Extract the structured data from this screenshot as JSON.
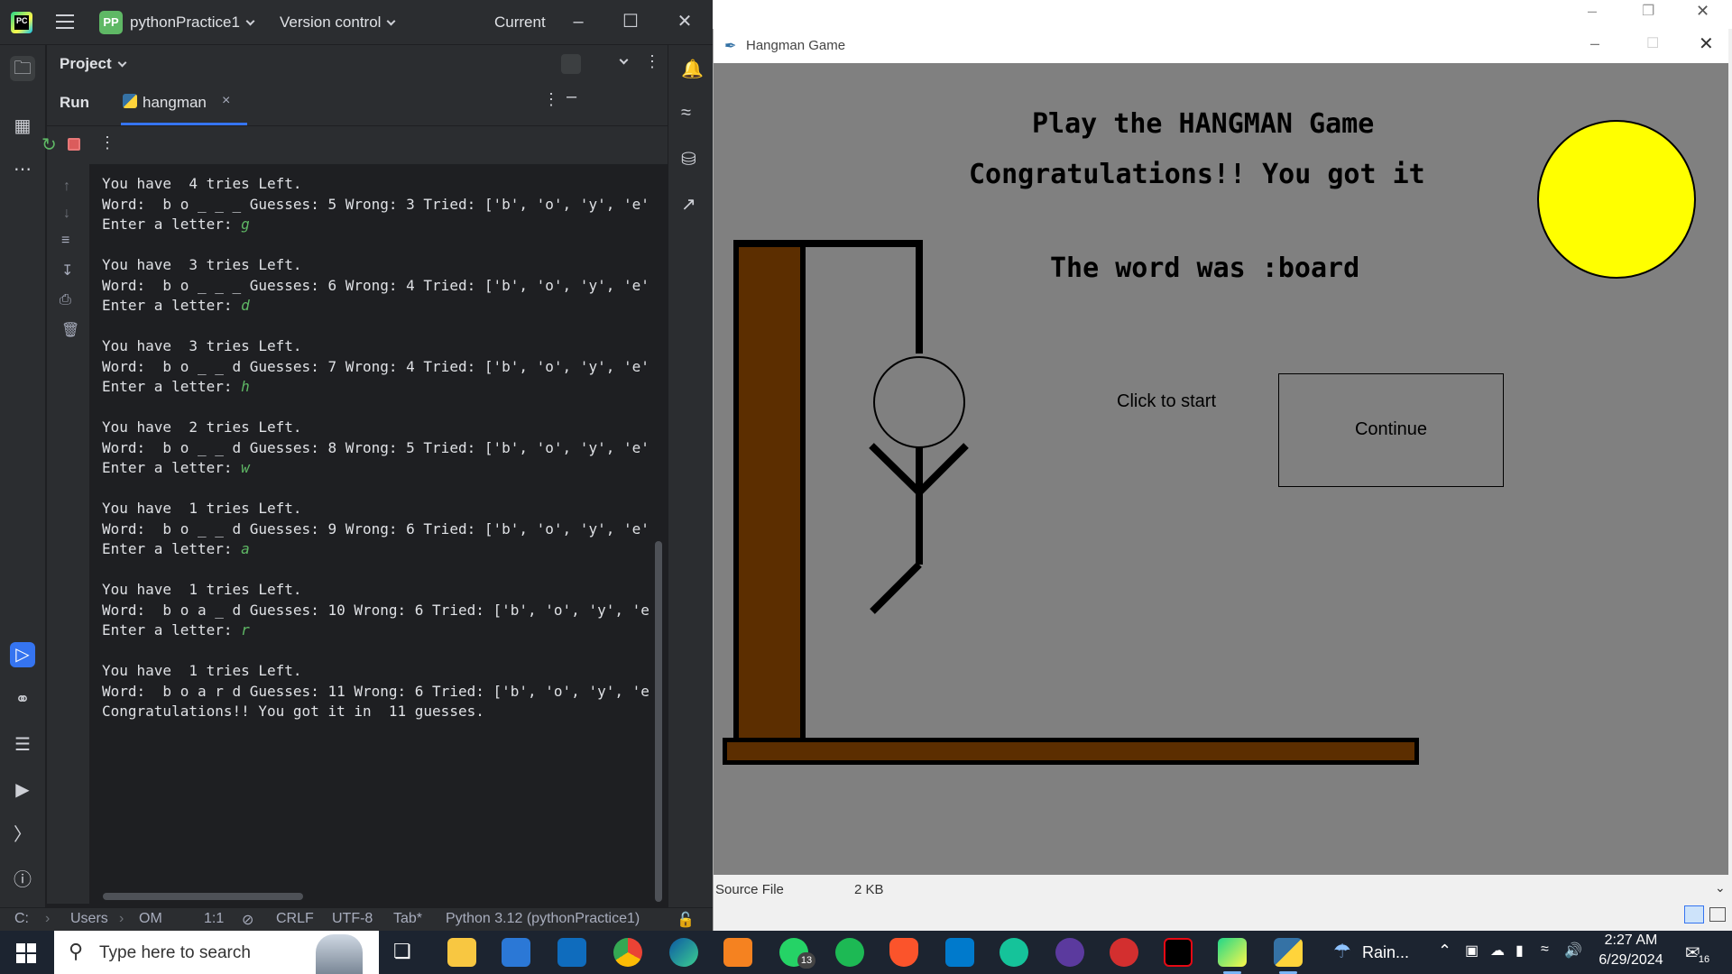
{
  "ide": {
    "project_badge": "PP",
    "project_name": "pythonPractice1",
    "version_control": "Version control",
    "run_config": "Current",
    "project_panel": "Project",
    "run_tab": "Run",
    "file_tab": "hangman",
    "console_lines": [
      {
        "text": "You have  4 tries Left."
      },
      {
        "text": "Word:  b o _ _ _ Guesses: 5 Wrong: 3 Tried: ['b', 'o', 'y', 'e'"
      },
      {
        "text": "Enter a letter: ",
        "input": "g"
      },
      {
        "text": ""
      },
      {
        "text": "You have  3 tries Left."
      },
      {
        "text": "Word:  b o _ _ _ Guesses: 6 Wrong: 4 Tried: ['b', 'o', 'y', 'e'"
      },
      {
        "text": "Enter a letter: ",
        "input": "d"
      },
      {
        "text": ""
      },
      {
        "text": "You have  3 tries Left."
      },
      {
        "text": "Word:  b o _ _ d Guesses: 7 Wrong: 4 Tried: ['b', 'o', 'y', 'e'"
      },
      {
        "text": "Enter a letter: ",
        "input": "h"
      },
      {
        "text": ""
      },
      {
        "text": "You have  2 tries Left."
      },
      {
        "text": "Word:  b o _ _ d Guesses: 8 Wrong: 5 Tried: ['b', 'o', 'y', 'e'"
      },
      {
        "text": "Enter a letter: ",
        "input": "w"
      },
      {
        "text": ""
      },
      {
        "text": "You have  1 tries Left."
      },
      {
        "text": "Word:  b o _ _ d Guesses: 9 Wrong: 6 Tried: ['b', 'o', 'y', 'e'"
      },
      {
        "text": "Enter a letter: ",
        "input": "a"
      },
      {
        "text": ""
      },
      {
        "text": "You have  1 tries Left."
      },
      {
        "text": "Word:  b o a _ d Guesses: 10 Wrong: 6 Tried: ['b', 'o', 'y', 'e"
      },
      {
        "text": "Enter a letter: ",
        "input": "r"
      },
      {
        "text": ""
      },
      {
        "text": "You have  1 tries Left."
      },
      {
        "text": "Word:  b o a r d Guesses: 11 Wrong: 6 Tried: ['b', 'o', 'y', 'e"
      },
      {
        "text": "Congratulations!! You got it in  11 guesses."
      }
    ],
    "status": {
      "path_drive": "C:",
      "path_users": "Users",
      "path_user": "OM",
      "position": "1:1",
      "line_sep": "CRLF",
      "encoding": "UTF-8",
      "indent": "Tab*",
      "interpreter": "Python 3.12 (pythonPractice1)"
    }
  },
  "hangman": {
    "window_title": "Hangman Game",
    "heading": "Play the HANGMAN Game",
    "message": "Congratulations!! You got it",
    "word_reveal": "The word was :board",
    "start_label": "Click to start",
    "continue_label": "Continue",
    "colors": {
      "canvas": "#808080",
      "gallows": "#5c2e00",
      "sun": "#ffff00"
    },
    "file_type": "Source File",
    "file_size": "2 KB"
  },
  "taskbar": {
    "search_placeholder": "Type here to search",
    "whatsapp_badge": "13",
    "weather": "Rain...",
    "time": "2:27 AM",
    "date": "6/29/2024",
    "notifications": "16"
  }
}
